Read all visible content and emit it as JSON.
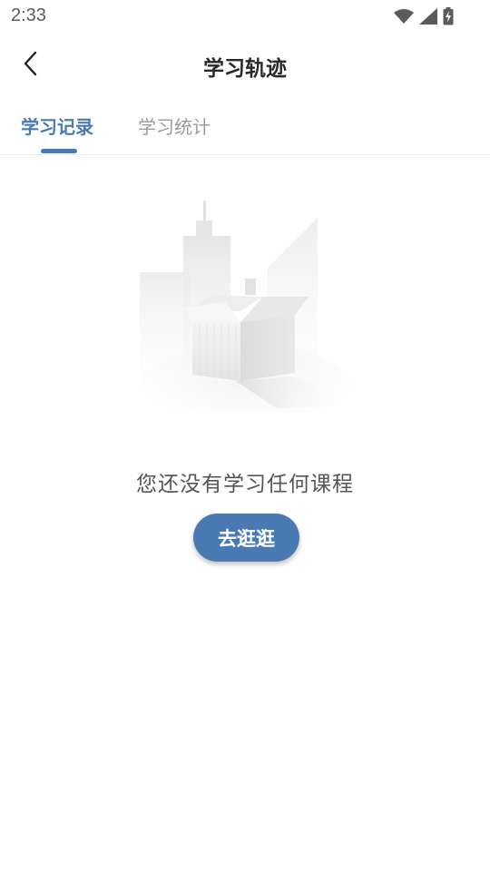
{
  "status_bar": {
    "time": "2:33"
  },
  "header": {
    "title": "学习轨迹",
    "back_icon": "chevron-left-icon"
  },
  "tabs": [
    {
      "label": "学习记录",
      "active": true
    },
    {
      "label": "学习统计",
      "active": false
    }
  ],
  "empty_state": {
    "message": "您还没有学习任何课程",
    "illustration": "empty-box-city-icon"
  },
  "actions": {
    "browse_label": "去逛逛"
  },
  "colors": {
    "accent": "#4a7ab3",
    "inactive_tab": "#9b9b9b",
    "message_text": "#555555"
  }
}
